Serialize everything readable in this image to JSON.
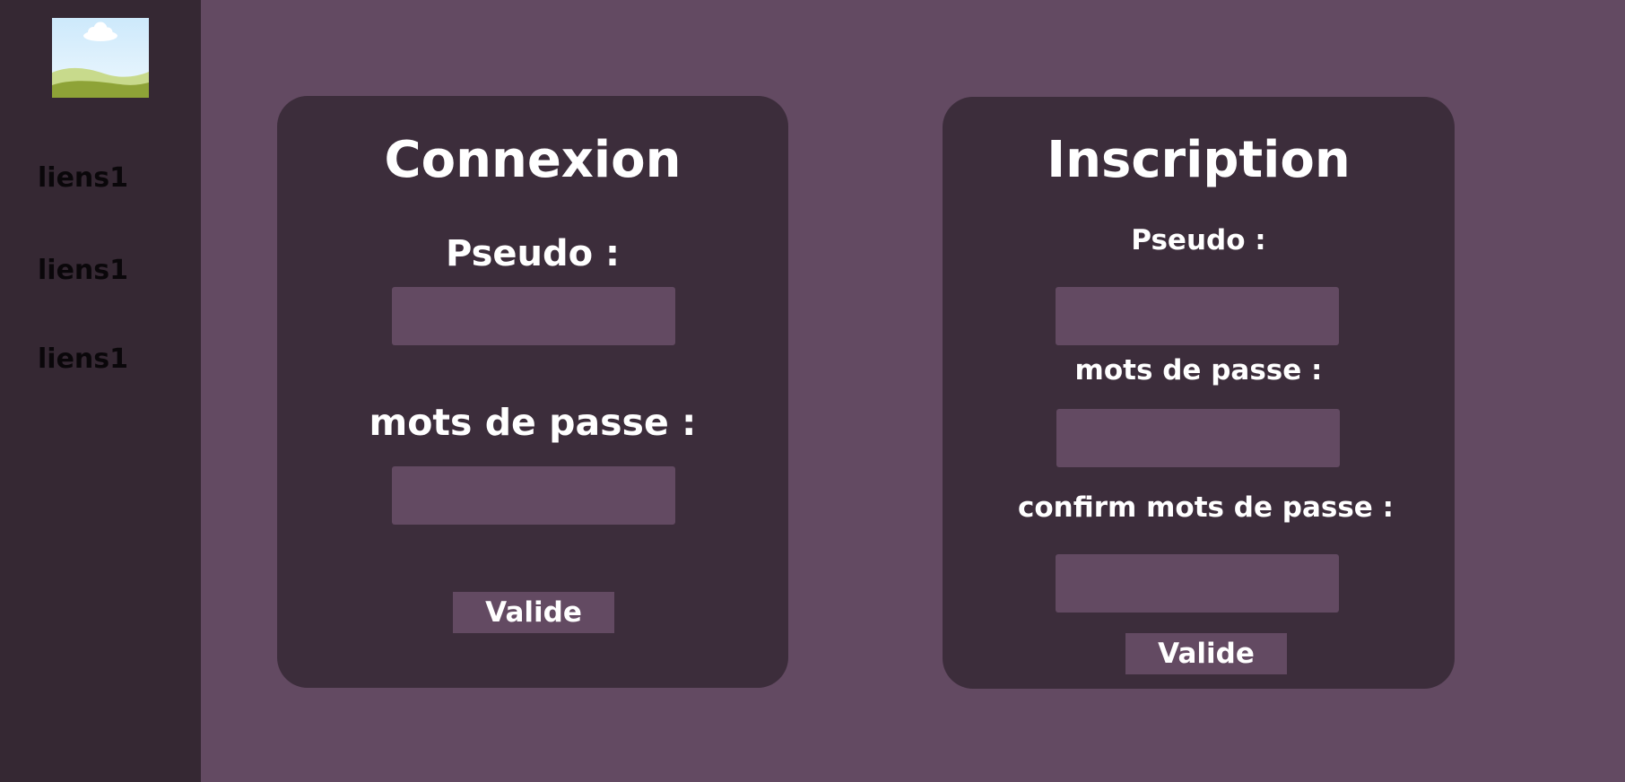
{
  "sidebar": {
    "logo_icon": "landscape-image-icon",
    "links": [
      "liens1",
      "liens1",
      "liens1"
    ]
  },
  "login": {
    "title": "Connexion",
    "pseudo_label": "Pseudo :",
    "pseudo_value": "",
    "password_label": "mots de passe :",
    "password_value": "",
    "submit_label": "Valide"
  },
  "register": {
    "title": "Inscription",
    "pseudo_label": "Pseudo :",
    "pseudo_value": "",
    "password_label": "mots de passe :",
    "password_value": "",
    "confirm_label": "confirm mots de passe :",
    "confirm_value": "",
    "submit_label": "Valide"
  },
  "colors": {
    "page_background": "#634a62",
    "sidebar_background": "#352833",
    "card_background": "#3c2d3b",
    "input_background": "#634a62",
    "text": "#ffffff",
    "link_text": "#0a070a"
  }
}
